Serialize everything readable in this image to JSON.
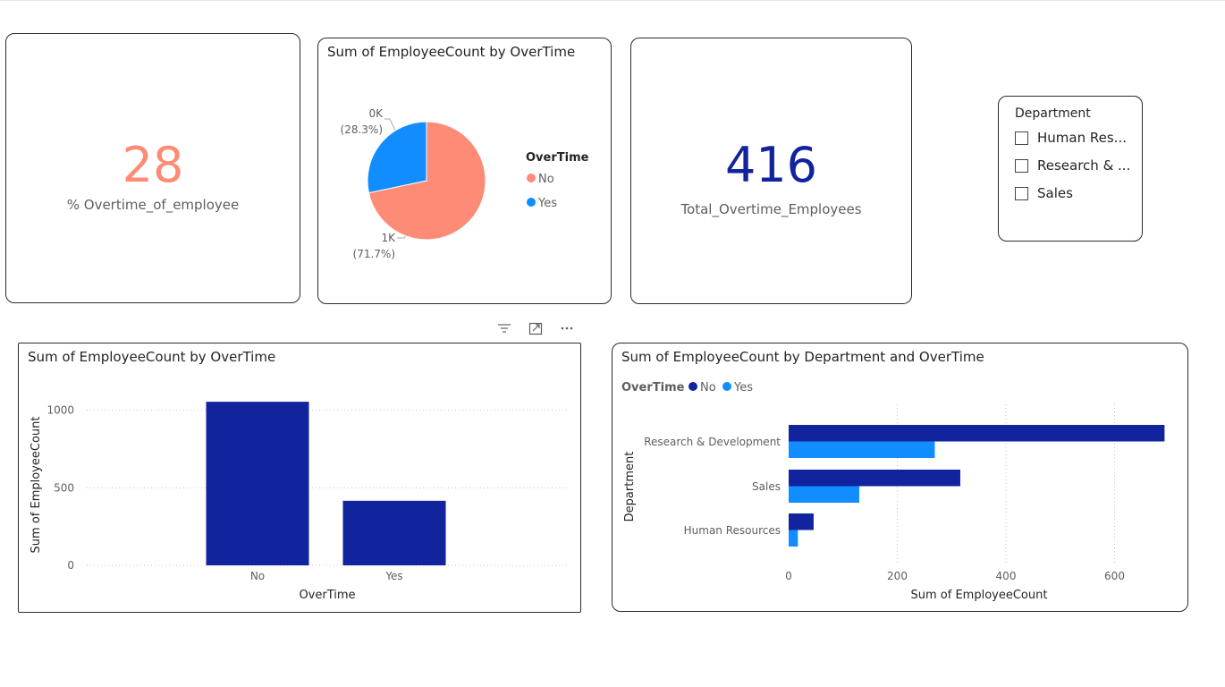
{
  "kpi_overtime_pct": {
    "value": "28",
    "label": "% Overtime_of_employee",
    "color": "#fd8b75"
  },
  "kpi_total_overtime": {
    "value": "416",
    "label": "Total_Overtime_Employees",
    "color": "#12239e"
  },
  "pie_card": {
    "title": "Sum of EmployeeCount by OverTime",
    "legend_title": "OverTime",
    "labels": [
      {
        "value": "0K",
        "pct": "(28.3%)"
      },
      {
        "value": "1K",
        "pct": "(71.7%)"
      }
    ]
  },
  "slicer": {
    "title": "Department",
    "items": [
      "Human Res...",
      "Research & ...",
      "Sales"
    ]
  },
  "toolbar": {
    "icons": [
      "filter-icon",
      "focus-mode-icon",
      "more-options-icon"
    ]
  },
  "bar_card": {
    "title": "Sum of EmployeeCount by OverTime"
  },
  "hbar_card": {
    "title": "Sum of EmployeeCount by Department and OverTime",
    "legend_title": "OverTime"
  },
  "colors": {
    "no_dark": "#12239e",
    "yes_light": "#118dff",
    "pie_no": "#fd8b75",
    "pie_yes": "#118dff"
  },
  "chart_data": [
    {
      "type": "pie",
      "title": "Sum of EmployeeCount by OverTime",
      "legend_title": "OverTime",
      "categories": [
        "No",
        "Yes"
      ],
      "values": [
        1054,
        416
      ],
      "percent": [
        71.7,
        28.3
      ]
    },
    {
      "type": "bar",
      "title": "Sum of EmployeeCount by OverTime",
      "xlabel": "OverTime",
      "ylabel": "Sum of EmployeeCount",
      "categories": [
        "No",
        "Yes"
      ],
      "values": [
        1054,
        416
      ],
      "ylim": [
        0,
        1100
      ],
      "yticks": [
        "0",
        "500",
        "1000"
      ],
      "grid": true
    },
    {
      "type": "bar",
      "orientation": "horizontal",
      "title": "Sum of EmployeeCount by Department and OverTime",
      "xlabel": "Sum of EmployeeCount",
      "ylabel": "Department",
      "legend_title": "OverTime",
      "legend_position": "top-left",
      "categories": [
        "Research & Development",
        "Sales",
        "Human Resources"
      ],
      "series": [
        {
          "name": "No",
          "values": [
            692,
            316,
            46
          ]
        },
        {
          "name": "Yes",
          "values": [
            269,
            130,
            17
          ]
        }
      ],
      "xlim": [
        0,
        700
      ],
      "xticks": [
        "0",
        "200",
        "400",
        "600"
      ],
      "grid": true
    }
  ]
}
